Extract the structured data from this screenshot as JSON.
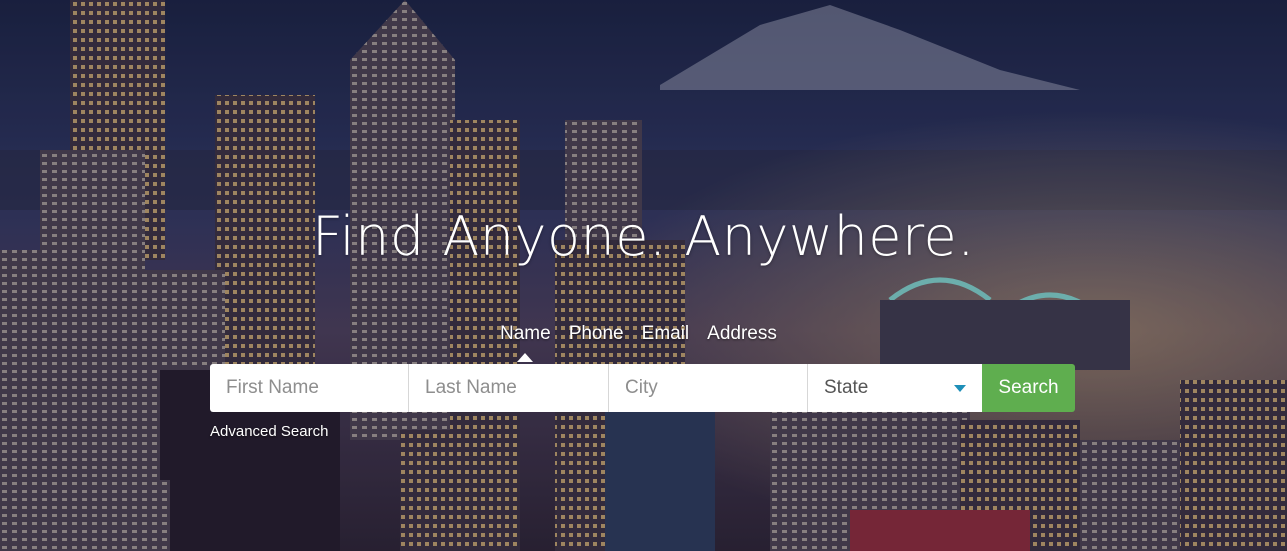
{
  "hero": {
    "headline": "Find Anyone. Anywhere.",
    "tabs": [
      {
        "label": "Name",
        "active": true
      },
      {
        "label": "Phone",
        "active": false
      },
      {
        "label": "Email",
        "active": false
      },
      {
        "label": "Address",
        "active": false
      }
    ]
  },
  "search": {
    "first_name_placeholder": "First Name",
    "last_name_placeholder": "Last Name",
    "city_placeholder": "City",
    "state_selected": "State",
    "button_label": "Search"
  },
  "advanced_search_label": "Advanced Search",
  "colors": {
    "button": "#5fae4f",
    "caret": "#1e8fb8",
    "text": "#ffffff"
  }
}
